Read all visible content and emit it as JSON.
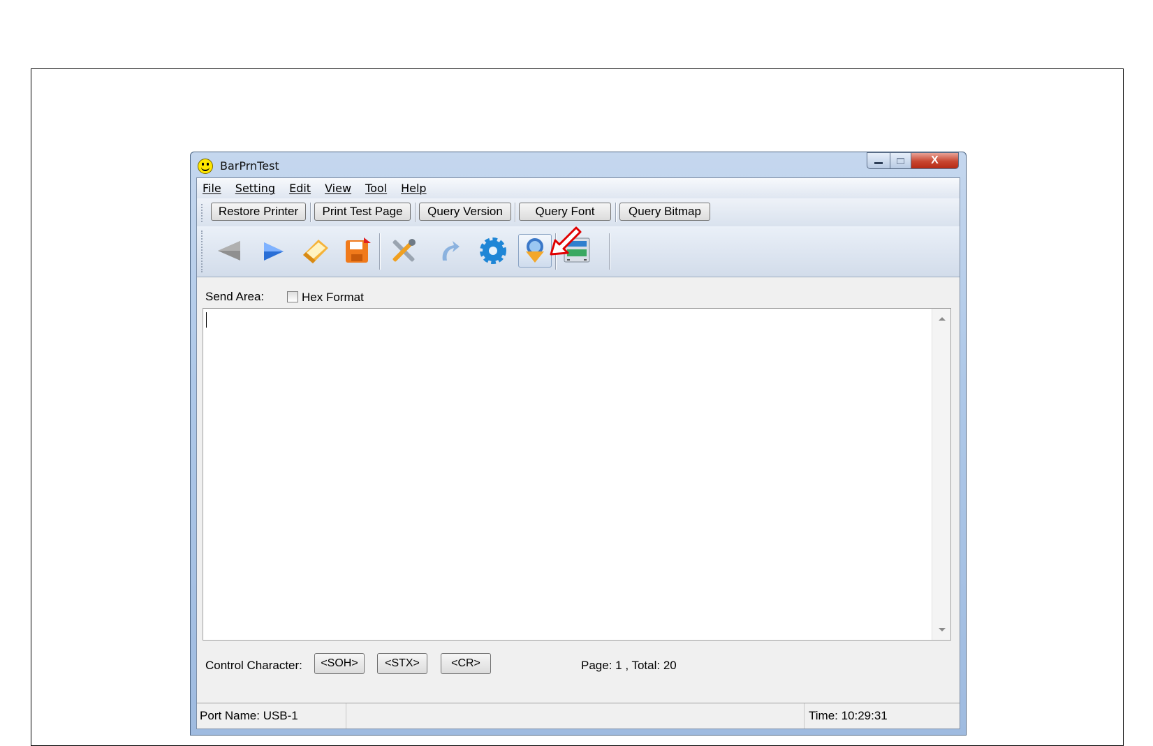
{
  "window": {
    "title": "BarPrnTest",
    "close_label": "X"
  },
  "menu": [
    {
      "label": "File"
    },
    {
      "label": "Setting"
    },
    {
      "label": "Edit"
    },
    {
      "label": "View"
    },
    {
      "label": "Tool"
    },
    {
      "label": "Help"
    }
  ],
  "toolbar_buttons": [
    {
      "label": "Restore Printer"
    },
    {
      "label": "Print Test Page"
    },
    {
      "label": "Query Version"
    },
    {
      "label": "Query Font"
    },
    {
      "label": "Query Bitmap"
    }
  ],
  "icon_toolbar": [
    {
      "icon": "arrow-left-icon"
    },
    {
      "icon": "arrow-right-icon"
    },
    {
      "icon": "open-folder-icon"
    },
    {
      "icon": "save-icon"
    },
    {
      "icon": "tools-icon"
    },
    {
      "icon": "redo-arrow-icon"
    },
    {
      "icon": "gear-icon"
    },
    {
      "icon": "download-font-icon",
      "active": true
    },
    {
      "icon": "printer-window-icon"
    }
  ],
  "send_area": {
    "label": "Send Area:",
    "hex_format_label": "Hex Format",
    "hex_format_checked": false,
    "content": ""
  },
  "control_character": {
    "label": "Control Character:",
    "buttons": [
      {
        "label": "<SOH>"
      },
      {
        "label": "<STX>"
      },
      {
        "label": "<CR>"
      }
    ]
  },
  "page_info": "Page: 1 , Total: 20",
  "status": {
    "port_name": "Port Name: USB-1",
    "middle": "",
    "time": "Time: 10:29:31"
  },
  "colors": {
    "annotation_arrow": "#e00000",
    "title_bar": "#b5cce9",
    "close_button": "#c8452f"
  }
}
